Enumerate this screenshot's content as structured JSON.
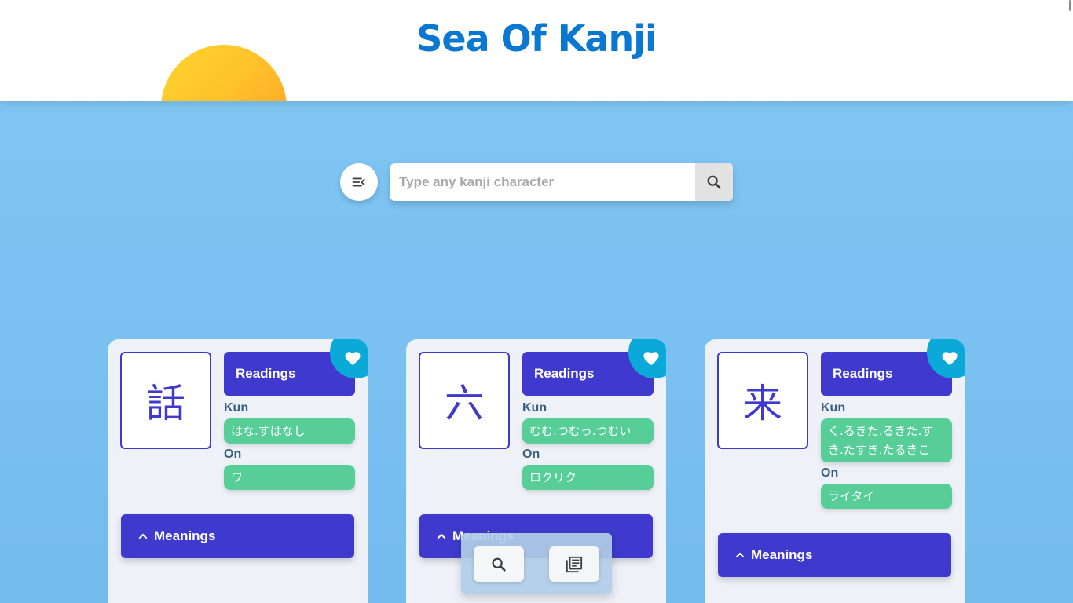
{
  "app": {
    "title": "Sea Of Kanji"
  },
  "search": {
    "placeholder": "Type any kanji character",
    "value": "",
    "menu_icon": "menu-open-icon",
    "search_icon": "search-icon"
  },
  "cards": [
    {
      "kanji": "話",
      "readings_label": "Readings",
      "kun_label": "Kun",
      "kun": "はな.すはなし",
      "on_label": "On",
      "on": "ワ",
      "meanings_label": "Meanings",
      "favorite_icon": "heart-icon"
    },
    {
      "kanji": "六",
      "readings_label": "Readings",
      "kun_label": "Kun",
      "kun": "むむ.つむっ.つむい",
      "on_label": "On",
      "on": "ロクリク",
      "meanings_label": "Meanings",
      "favorite_icon": "heart-icon"
    },
    {
      "kanji": "来",
      "readings_label": "Readings",
      "kun_label": "Kun",
      "kun": "く.るきた.るきた.すき.たすき.たるきこ",
      "on_label": "On",
      "on": "ライタイ",
      "meanings_label": "Meanings",
      "favorite_icon": "heart-icon"
    }
  ],
  "dock": {
    "search_icon": "search-icon",
    "library_icon": "library-books-icon"
  },
  "colors": {
    "brand": "#0a78d2",
    "card_accent": "#3f3acd",
    "reading_pill": "#57cd98",
    "favorite": "#0aa9d8",
    "background": "#7dc3f2"
  }
}
